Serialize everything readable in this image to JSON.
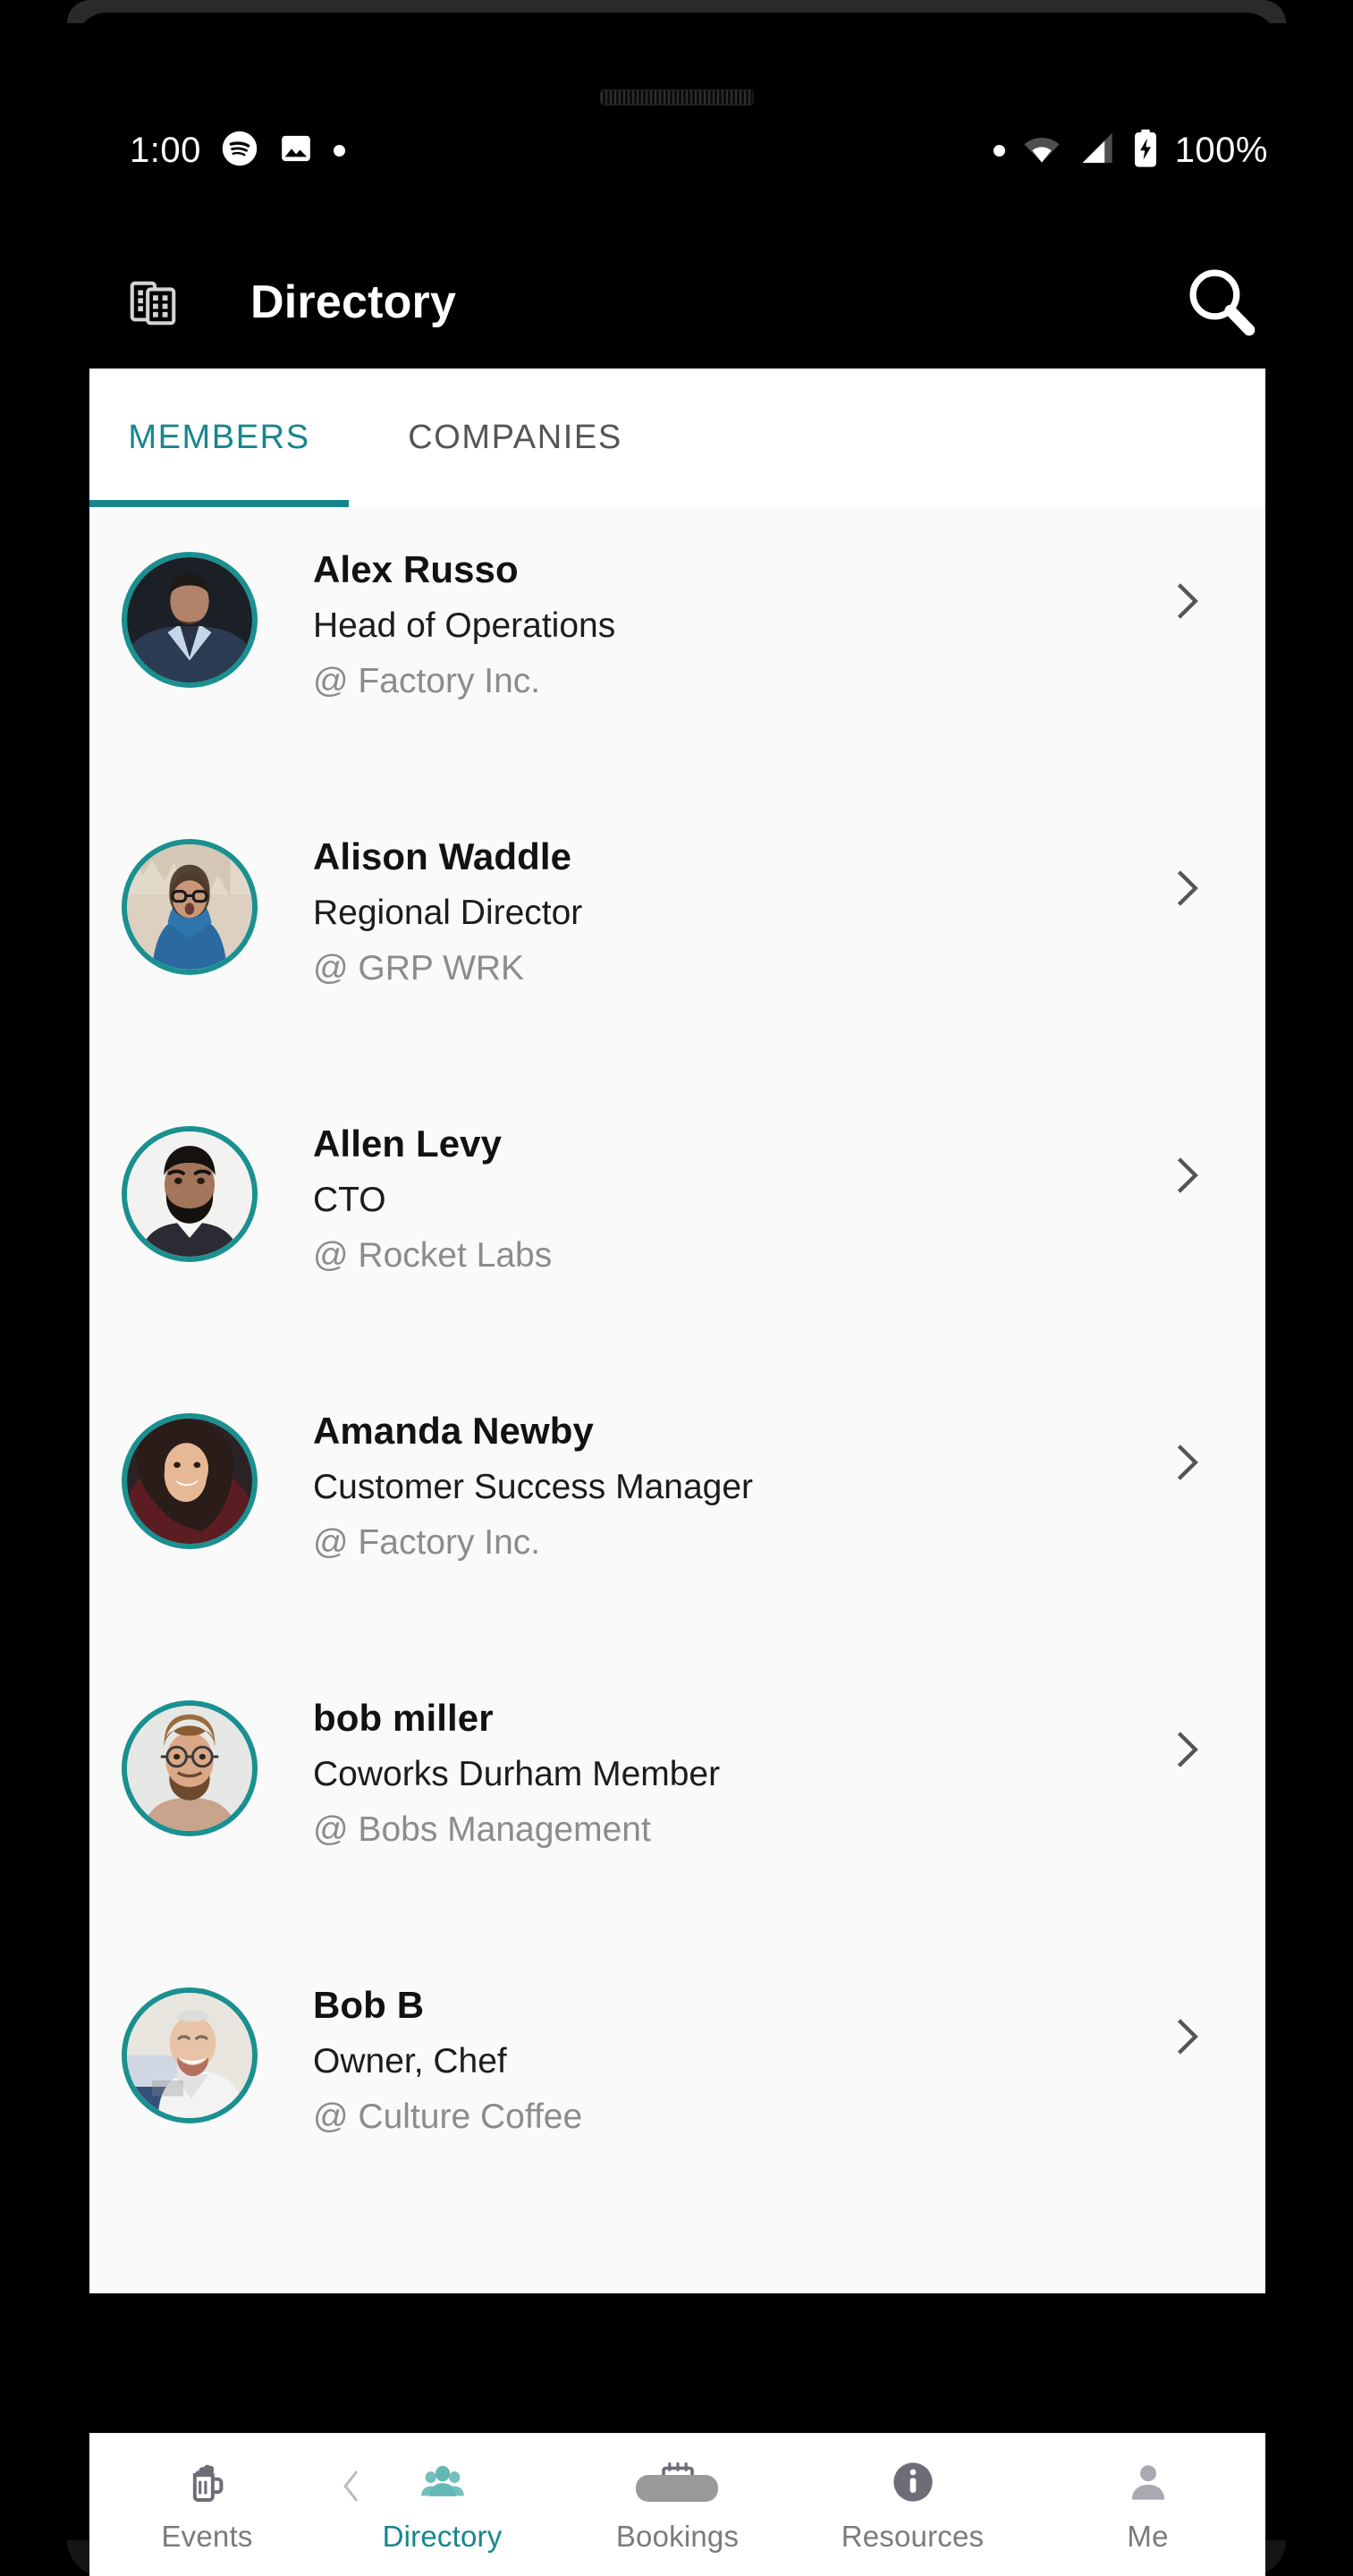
{
  "statusbar": {
    "time": "1:00",
    "battery_text": "100%",
    "left_icons": [
      "spotify-icon",
      "photo-icon",
      "notification-dot-icon"
    ],
    "right_icons": [
      "notification-dot-icon",
      "wifi-icon",
      "cellular-signal-icon",
      "battery-charging-icon"
    ]
  },
  "appbar": {
    "icon": "buildings-icon",
    "title": "Directory",
    "search_icon": "search-icon"
  },
  "tabs": {
    "items": [
      {
        "label": "MEMBERS",
        "active": true
      },
      {
        "label": "COMPANIES",
        "active": false
      }
    ],
    "active_color": "#17868c",
    "inactive_color": "#555555"
  },
  "members": [
    {
      "name": "Alex Russo",
      "role": "Head of Operations",
      "company": "@ Factory Inc."
    },
    {
      "name": "Alison Waddle",
      "role": "Regional Director",
      "company": "@ GRP WRK"
    },
    {
      "name": "Allen Levy",
      "role": "CTO",
      "company": "@ Rocket Labs"
    },
    {
      "name": "Amanda Newby",
      "role": "Customer Success Manager",
      "company": "@ Factory Inc."
    },
    {
      "name": "bob miller",
      "role": "Coworks Durham Member",
      "company": "@ Bobs Management"
    },
    {
      "name": "Bob B",
      "role": "Owner, Chef",
      "company": "@ Culture Coffee"
    }
  ],
  "bottom_nav": {
    "items": [
      {
        "label": "Events",
        "icon": "beer-mug-icon",
        "active": false
      },
      {
        "label": "Directory",
        "icon": "people-icon",
        "active": true
      },
      {
        "label": "Bookings",
        "icon": "calendar-icon",
        "active": false
      },
      {
        "label": "Resources",
        "icon": "info-circle-icon",
        "active": false
      },
      {
        "label": "Me",
        "icon": "person-icon",
        "active": false
      }
    ]
  },
  "system_nav": {
    "back_icon": "chevron-left-icon",
    "home_pill": "home-indicator-pill"
  },
  "colors": {
    "accent_teal": "#17868c",
    "avatar_ring": "#1a9090",
    "app_background": "#fafafa",
    "header_background": "#000000"
  }
}
